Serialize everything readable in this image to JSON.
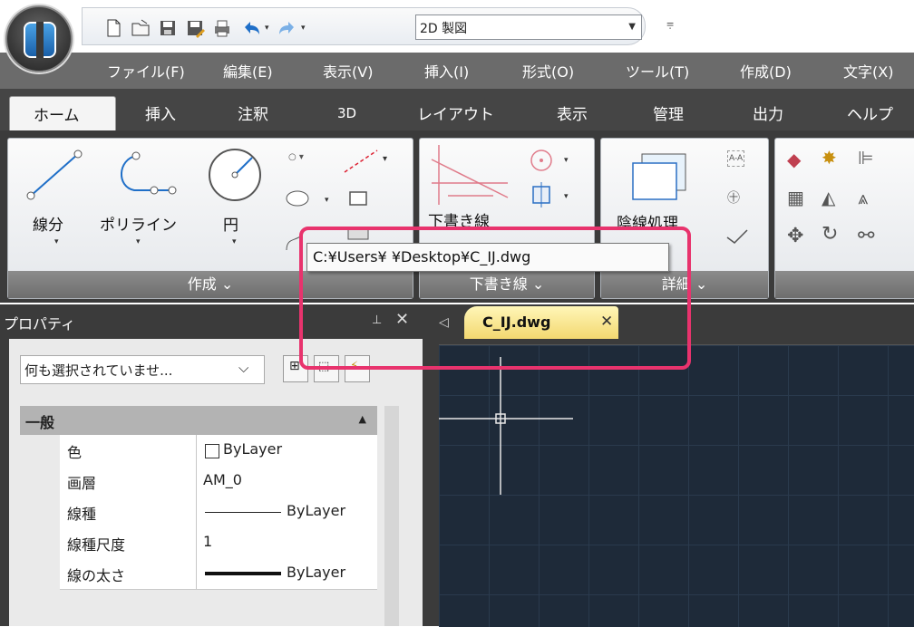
{
  "quick_access": {
    "workspace": "2D 製図",
    "customize_glyph": "⩦"
  },
  "menubar": {
    "items": [
      "ファイル(F)",
      "編集(E)",
      "表示(V)",
      "挿入(I)",
      "形式(O)",
      "ツール(T)",
      "作成(D)",
      "文字(X)"
    ]
  },
  "ribbon": {
    "tabs": [
      "ホーム",
      "挿入",
      "注釈",
      "3D",
      "レイアウト",
      "表示",
      "管理",
      "出力",
      "ヘルプ"
    ],
    "active_tab": "ホーム",
    "panels": {
      "create": {
        "footer": "作成 ⌄",
        "tools": [
          "線分",
          "ポリライン",
          "円"
        ]
      },
      "draft": {
        "footer": "下書き線 ⌄",
        "tools": [
          "下書き線"
        ]
      },
      "detail": {
        "footer": "詳細 ⌄",
        "tools": [
          "陰線処理"
        ]
      }
    }
  },
  "properties": {
    "title": "プロパティ",
    "pin_glyph": "⊥",
    "close_glyph": "✕",
    "selection": "何も選択されていませ...",
    "category": "一般",
    "rows": [
      {
        "key": "色",
        "value": "ByLayer"
      },
      {
        "key": "画層",
        "value": "AM_0"
      },
      {
        "key": "線種",
        "value": "ByLayer"
      },
      {
        "key": "線種尺度",
        "value": "1"
      },
      {
        "key": "線の太さ",
        "value": "ByLayer"
      }
    ]
  },
  "document": {
    "tab_name": "C_IJ.dwg",
    "close_glyph": "✕",
    "nav_glyph": "◁"
  },
  "tooltip": {
    "path": "C:¥Users¥                ¥Desktop¥C_IJ.dwg"
  },
  "colors": {
    "highlight": "#e8336d",
    "doc_tab": "#f3d870",
    "canvas": "#1e2a39"
  }
}
